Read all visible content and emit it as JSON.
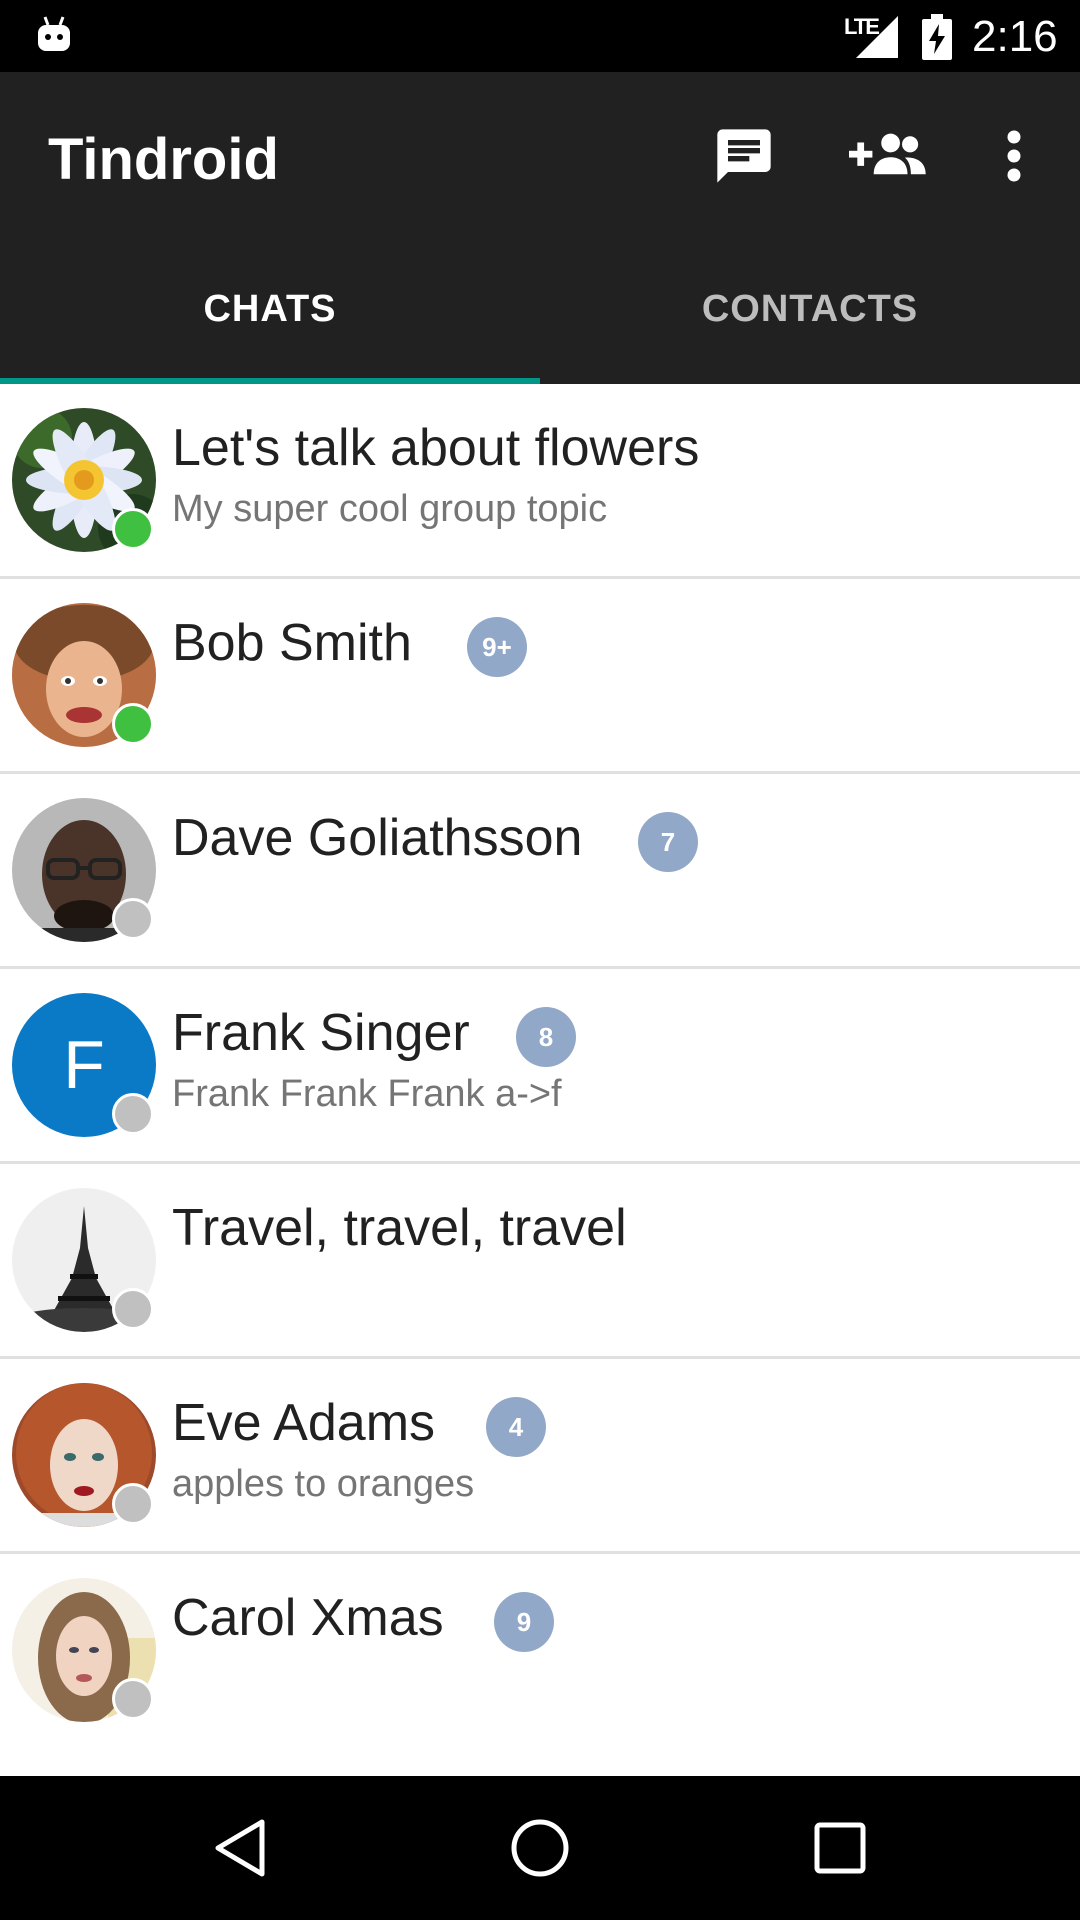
{
  "status_bar": {
    "network": "LTE",
    "time": "2:16"
  },
  "app_bar": {
    "title": "Tindroid",
    "actions": [
      {
        "icon": "new-chat-icon"
      },
      {
        "icon": "add-contact-icon"
      },
      {
        "icon": "overflow-menu-icon"
      }
    ]
  },
  "tabs": [
    {
      "label": "CHATS",
      "selected": true
    },
    {
      "label": "CONTACTS",
      "selected": false
    }
  ],
  "accent_color": "#009688",
  "chats": [
    {
      "name": "Let's talk about flowers",
      "subtitle": "My super cool group topic",
      "badge": "",
      "online": true,
      "avatar": "flower-photo"
    },
    {
      "name": "Bob Smith",
      "subtitle": "",
      "badge": "9+",
      "online": true,
      "avatar": "bob-photo"
    },
    {
      "name": "Dave Goliathsson",
      "subtitle": "",
      "badge": "7",
      "online": false,
      "avatar": "dave-photo"
    },
    {
      "name": "Frank Singer",
      "subtitle": "Frank Frank Frank a->f",
      "badge": "8",
      "online": false,
      "avatar": "letter-avatar",
      "avatar_letter": "F",
      "avatar_color": "#0a7ac7"
    },
    {
      "name": "Travel, travel, travel",
      "subtitle": "",
      "badge": "",
      "online": false,
      "avatar": "eiffel-tower-photo"
    },
    {
      "name": "Eve Adams",
      "subtitle": "apples to oranges",
      "badge": "4",
      "online": false,
      "avatar": "eve-photo"
    },
    {
      "name": "Carol Xmas",
      "subtitle": "",
      "badge": "9",
      "online": false,
      "avatar": "carol-photo"
    }
  ],
  "nav_bar": {
    "buttons": [
      "back",
      "home",
      "recents"
    ]
  }
}
